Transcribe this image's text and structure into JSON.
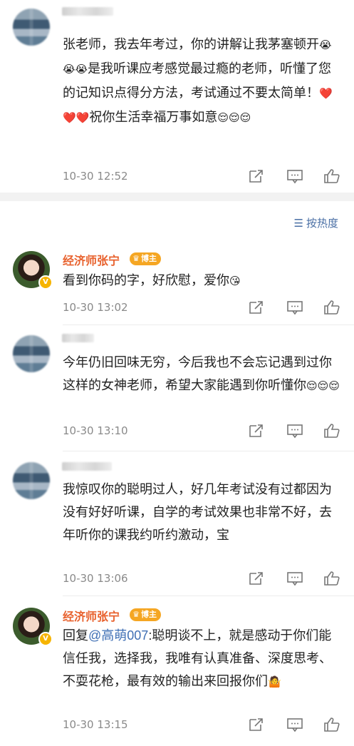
{
  "sort_label": "按热度",
  "comments": [
    {
      "name": "",
      "text_parts": [
        "张老师，我去年考过，你的讲解让我茅塞顿开",
        "😭😭😭",
        "是我听课应考感觉最过瘾的老师，听懂了您的记知识点得分方法，考试通过不要太简单！",
        "❤️❤️❤️",
        "祝你生活幸福万事如意",
        "😌😌😌"
      ],
      "time": "10-30 12:52"
    },
    {
      "name": "经济师张宁",
      "badge": "博主",
      "text_parts": [
        "看到你码的字，好欣慰，爱你",
        "😘"
      ],
      "time": "10-30 13:02"
    },
    {
      "name": "",
      "text_parts": [
        "今年仍旧回味无穷，今后我也不会忘记遇到过你这样的女神老师，希望大家能遇到你听懂你",
        "😌😌😌"
      ],
      "time": "10-30 13:10"
    },
    {
      "name": "",
      "text_parts": [
        "我惊叹你的聪明过人，好几年考试没有过都因为没有好好听课，自学的考试效果也非常不好，去年听你的课我约听约激动，宝"
      ],
      "time": "10-30 13:06"
    },
    {
      "name": "经济师张宁",
      "badge": "博主",
      "reply_prefix": "回复",
      "reply_to": "@高萌007",
      "text_parts": [
        ":聪明谈不上，就是感动于你们能信任我，选择我，我唯有认真准备、深度思考、不耍花枪，最有效的输出来回报你们",
        "🤷"
      ],
      "time": "10-30 13:15"
    }
  ],
  "icons": [
    "share-icon",
    "comment-icon",
    "like-icon"
  ]
}
